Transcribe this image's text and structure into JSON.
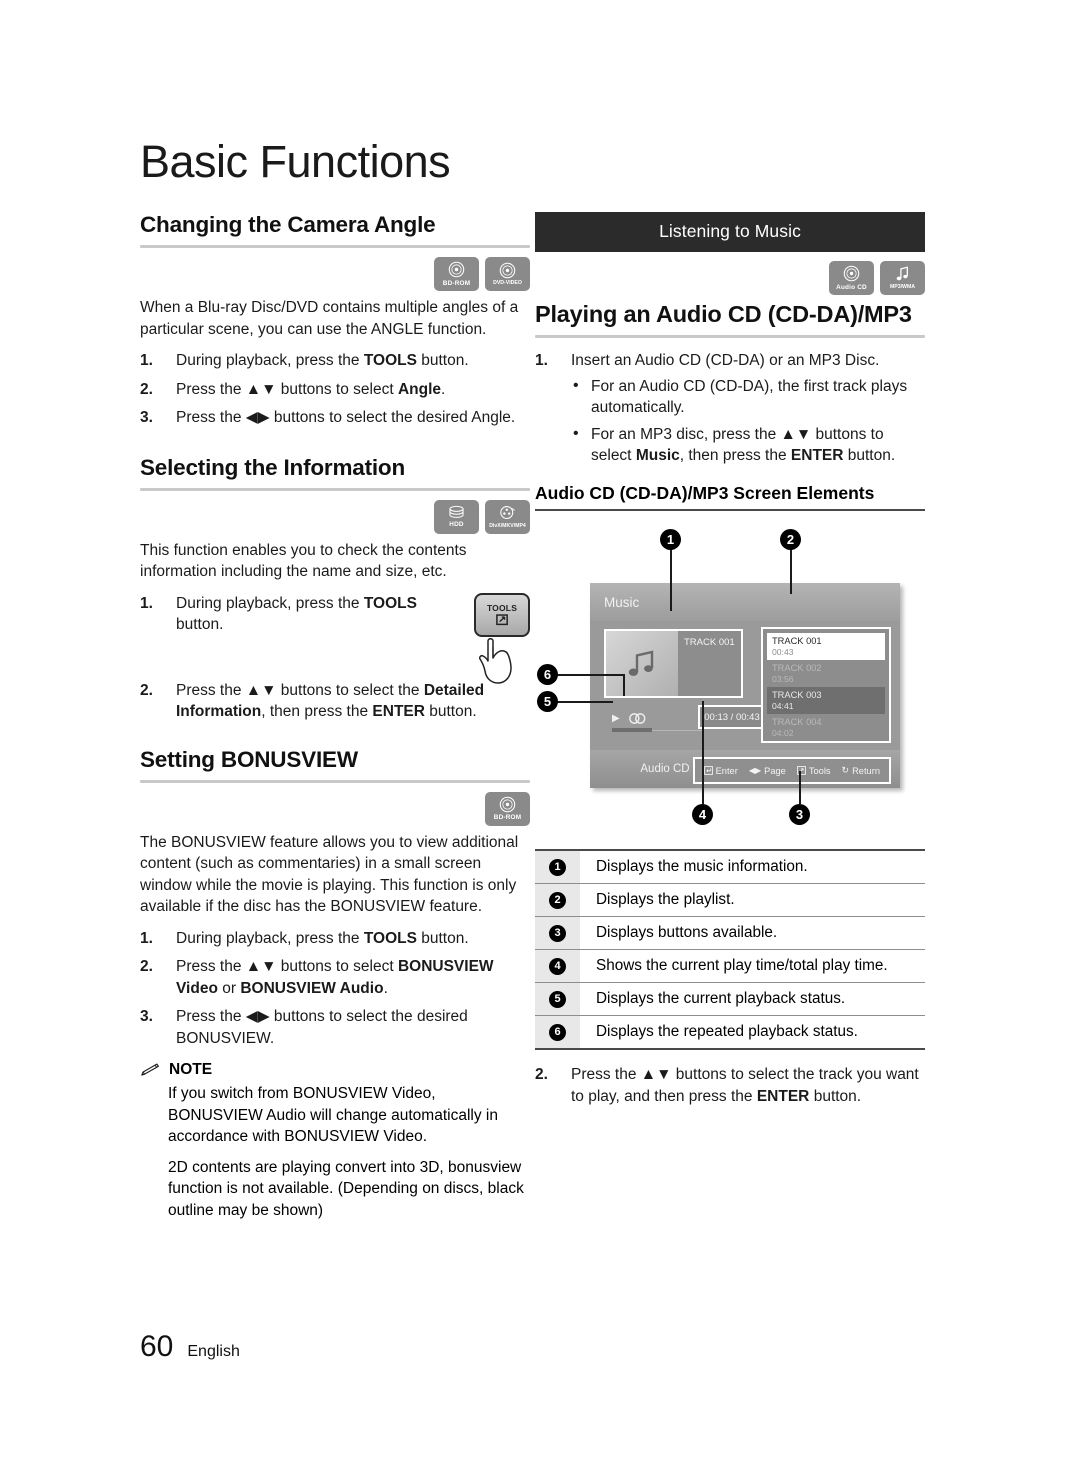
{
  "chapter": {
    "title": "Basic Functions"
  },
  "footer": {
    "page_number": "60",
    "language": "English"
  },
  "left_column": {
    "camera_angle": {
      "heading": "Changing the Camera Angle",
      "badges": [
        {
          "icon": "bd-rom-disc-icon",
          "caption": "BD-ROM"
        },
        {
          "icon": "dvd-video-disc-icon",
          "caption": "DVD-VIDEO"
        }
      ],
      "intro": "When a Blu-ray Disc/DVD contains multiple angles of a particular scene, you can use the ANGLE function.",
      "steps": [
        {
          "num": "1.",
          "html": "During playback, press the <b>TOOLS</b> button."
        },
        {
          "num": "2.",
          "html": "Press the ▲▼ buttons to select <b>Angle</b>."
        },
        {
          "num": "3.",
          "html": "Press the ◀▶ buttons to select the desired Angle."
        }
      ]
    },
    "selecting_information": {
      "heading": "Selecting the Information",
      "badges": [
        {
          "icon": "hdd-icon",
          "caption": "HDD"
        },
        {
          "icon": "divx-mkv-mp4-disc-icon",
          "caption": "DivX/MKV/MP4"
        }
      ],
      "intro": "This function enables you to check the contents information including the name and size, etc.",
      "tools_key_label": "TOOLS",
      "steps": [
        {
          "num": "1.",
          "html": "During playback, press the <b>TOOLS</b> button."
        },
        {
          "num": "2.",
          "html": "Press the ▲▼ buttons to select the <b>Detailed Information</b>, then press the <b>ENTER</b> button."
        }
      ]
    },
    "bonusview": {
      "heading": "Setting BONUSVIEW",
      "badges": [
        {
          "icon": "bd-rom-disc-icon",
          "caption": "BD-ROM"
        }
      ],
      "intro": "The BONUSVIEW feature allows you to view additional content (such as commentaries) in a small screen window while the movie is playing. This function is only available if the disc has the BONUSVIEW feature.",
      "steps": [
        {
          "num": "1.",
          "html": "During playback, press the <b>TOOLS</b> button."
        },
        {
          "num": "2.",
          "html": "Press the ▲▼ buttons to select <b>BONUSVIEW Video</b> or <b>BONUSVIEW Audio</b>."
        },
        {
          "num": "3.",
          "html": "Press the ◀▶ buttons to select the desired BONUSVIEW."
        }
      ],
      "note": {
        "icon": "pencil-note-icon",
        "label": "NOTE",
        "paragraphs": [
          "If you switch from BONUSVIEW Video, BONUSVIEW Audio will change automatically in accordance with BONUSVIEW Video.",
          "2D contents are playing convert into 3D, bonusview function is not available. (Depending on discs, black outline may be shown)"
        ]
      }
    }
  },
  "right_column": {
    "banner": "Listening to Music",
    "badges": [
      {
        "icon": "audio-cd-disc-icon",
        "caption": "Audio CD"
      },
      {
        "icon": "mp3-wma-note-icon",
        "caption": "MP3/WMA"
      }
    ],
    "heading": "Playing an Audio CD (CD-DA)/MP3",
    "steps": [
      {
        "num": "1.",
        "html": "Insert an Audio CD (CD-DA) or an MP3 Disc.",
        "bullets": [
          "For an Audio CD (CD-DA), the first track plays automatically.",
          "For an MP3 disc, press the ▲▼ buttons to select <b>Music</b>, then press the <b>ENTER</b> button."
        ]
      }
    ],
    "screen_elements": {
      "heading": "Audio CD (CD-DA)/MP3 Screen Elements",
      "callouts": [
        "1",
        "2",
        "3",
        "4",
        "5",
        "6"
      ],
      "screen": {
        "title": "Music",
        "now_playing": {
          "track_label": "TRACK 001",
          "time": "00:13 / 00:43"
        },
        "playlist": [
          {
            "name": "TRACK 001",
            "time": "00:43",
            "state": "selected"
          },
          {
            "name": "TRACK 002",
            "time": "03:56",
            "state": "normal"
          },
          {
            "name": "TRACK 003",
            "time": "04:41",
            "state": "highlighted"
          },
          {
            "name": "TRACK 004",
            "time": "04:02",
            "state": "normal"
          }
        ],
        "source_label": "Audio CD",
        "button_hints": [
          {
            "icon": "enter-key-icon",
            "label": "Enter"
          },
          {
            "icon": "left-right-arrows-icon",
            "label": "Page"
          },
          {
            "icon": "tools-key-icon",
            "label": "Tools"
          },
          {
            "icon": "return-arrow-icon",
            "label": "Return"
          }
        ]
      },
      "legend": [
        {
          "num": "1",
          "text": "Displays the music information."
        },
        {
          "num": "2",
          "text": "Displays the playlist."
        },
        {
          "num": "3",
          "text": "Displays buttons available."
        },
        {
          "num": "4",
          "text": "Shows the current play time/total play time."
        },
        {
          "num": "5",
          "text": "Displays the current playback status."
        },
        {
          "num": "6",
          "text": "Displays the repeated playback status."
        }
      ]
    },
    "step2": {
      "num": "2.",
      "html": "Press the ▲▼ buttons to select the track you want to play, and then press the <b>ENTER</b> button."
    }
  }
}
